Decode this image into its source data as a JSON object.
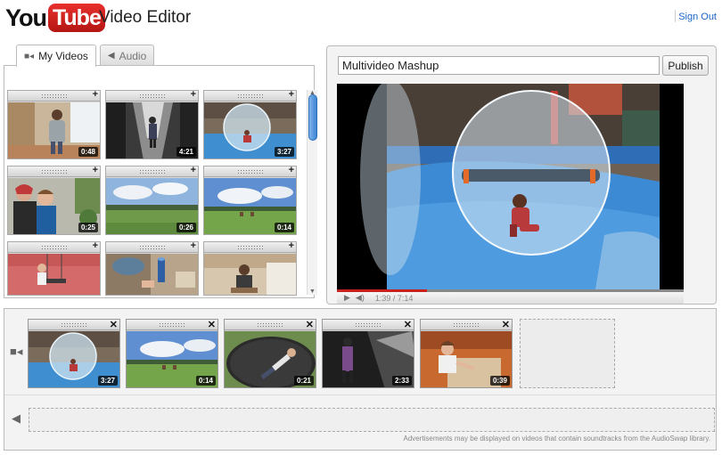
{
  "header": {
    "logo_you": "You",
    "logo_tube": "Tube",
    "title": "Video Editor",
    "sign_out": "Sign Out"
  },
  "library": {
    "tabs": [
      {
        "label": "My Videos",
        "icon": "camera-icon",
        "active": true
      },
      {
        "label": "Audio",
        "icon": "speaker-icon",
        "active": false
      }
    ],
    "thumbnails": [
      {
        "scene": "boy-at-door",
        "duration": "0:48",
        "action": "+"
      },
      {
        "scene": "kid-in-hallway",
        "duration": "4:21",
        "action": "+"
      },
      {
        "scene": "water-ball",
        "duration": "3:27",
        "action": "+"
      },
      {
        "scene": "kids-closeup",
        "duration": "0:25",
        "action": "+"
      },
      {
        "scene": "field-sky",
        "duration": "0:26",
        "action": "+"
      },
      {
        "scene": "field-sky-2",
        "duration": "0:14",
        "action": "+"
      },
      {
        "scene": "kid-on-swing",
        "duration": "",
        "action": "+"
      },
      {
        "scene": "hands-on-table",
        "duration": "",
        "action": "+"
      },
      {
        "scene": "kid-on-floor",
        "duration": "",
        "action": "+"
      }
    ]
  },
  "preview": {
    "title_value": "Multivideo Mashup",
    "publish_label": "Publish",
    "time": "1:39 / 7:14",
    "progress": 0.26
  },
  "timeline": {
    "clips": [
      {
        "scene": "water-ball",
        "duration": "3:27",
        "action": "✕"
      },
      {
        "scene": "field-sky-2",
        "duration": "0:14",
        "action": "✕"
      },
      {
        "scene": "trampoline",
        "duration": "0:21",
        "action": "✕"
      },
      {
        "scene": "dark-room",
        "duration": "2:33",
        "action": "✕"
      },
      {
        "scene": "kid-drawing",
        "duration": "0:39",
        "action": "✕"
      }
    ],
    "ads_note": "Advertisements may be displayed on videos that contain soundtracks from the AudioSwap library."
  }
}
